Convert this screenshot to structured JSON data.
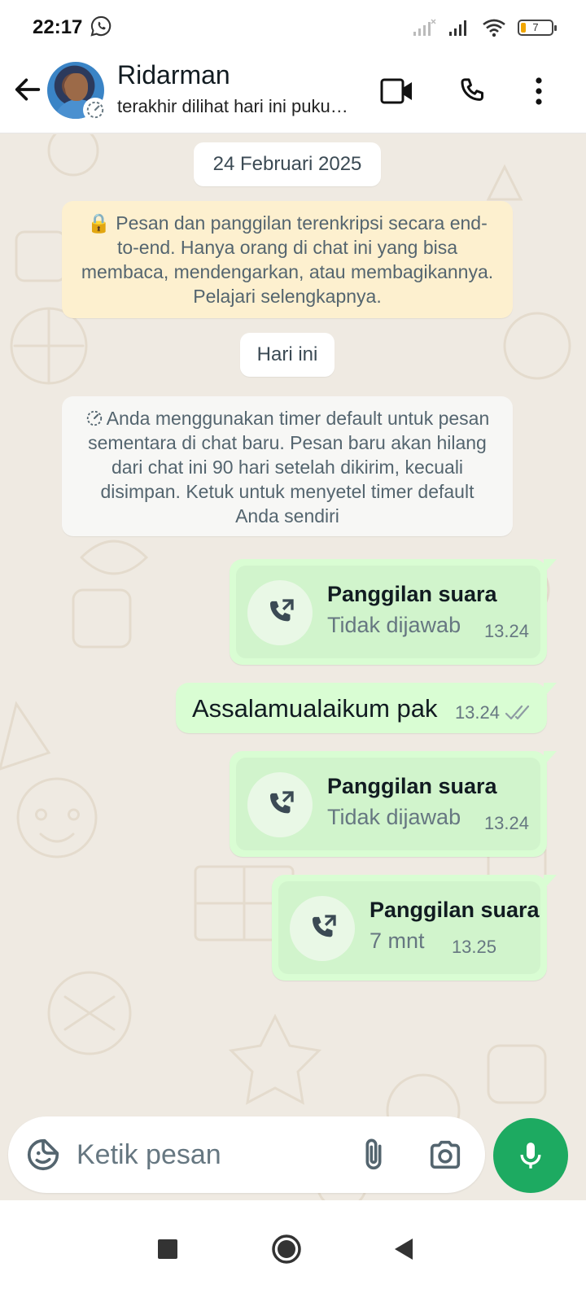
{
  "status_bar": {
    "time": "22:17",
    "battery": "7"
  },
  "header": {
    "contact_name": "Ridarman",
    "contact_status": "terakhir dilihat hari ini puku…",
    "icons": [
      "back-arrow-icon",
      "video-call-icon",
      "voice-call-icon",
      "more-vert-icon"
    ]
  },
  "chat": {
    "date_pill": "24 Februari 2025",
    "encryption_notice": "🔒 Pesan dan panggilan terenkripsi secara end-to-end. Hanya orang di chat ini yang bisa membaca, mendengarkan, atau membagikannya. Pelajari selengkapnya.",
    "today_pill": "Hari ini",
    "timer_notice": "Anda menggunakan timer default untuk pesan sementara di chat baru. Pesan baru akan hilang dari chat ini 90 hari setelah dikirim, kecuali disimpan. Ketuk untuk menyetel timer default Anda sendiri",
    "messages": [
      {
        "type": "call",
        "title": "Panggilan suara",
        "subtitle": "Tidak dijawab",
        "time": "13.24"
      },
      {
        "type": "text",
        "text": "Assalamualaikum pak",
        "time": "13.24",
        "status": "read"
      },
      {
        "type": "call",
        "title": "Panggilan suara",
        "subtitle": "Tidak dijawab",
        "time": "13.24"
      },
      {
        "type": "call",
        "title": "Panggilan suara",
        "subtitle": "7 mnt",
        "time": "13.25"
      }
    ]
  },
  "composer": {
    "placeholder": "Ketik pesan"
  },
  "colors": {
    "accent": "#1daa61",
    "outgoing_bubble": "#d9fdd3",
    "chat_background": "#efeae2",
    "encryption_notice_bg": "#fdf0cf",
    "read_tick": "#8e9ba3"
  }
}
